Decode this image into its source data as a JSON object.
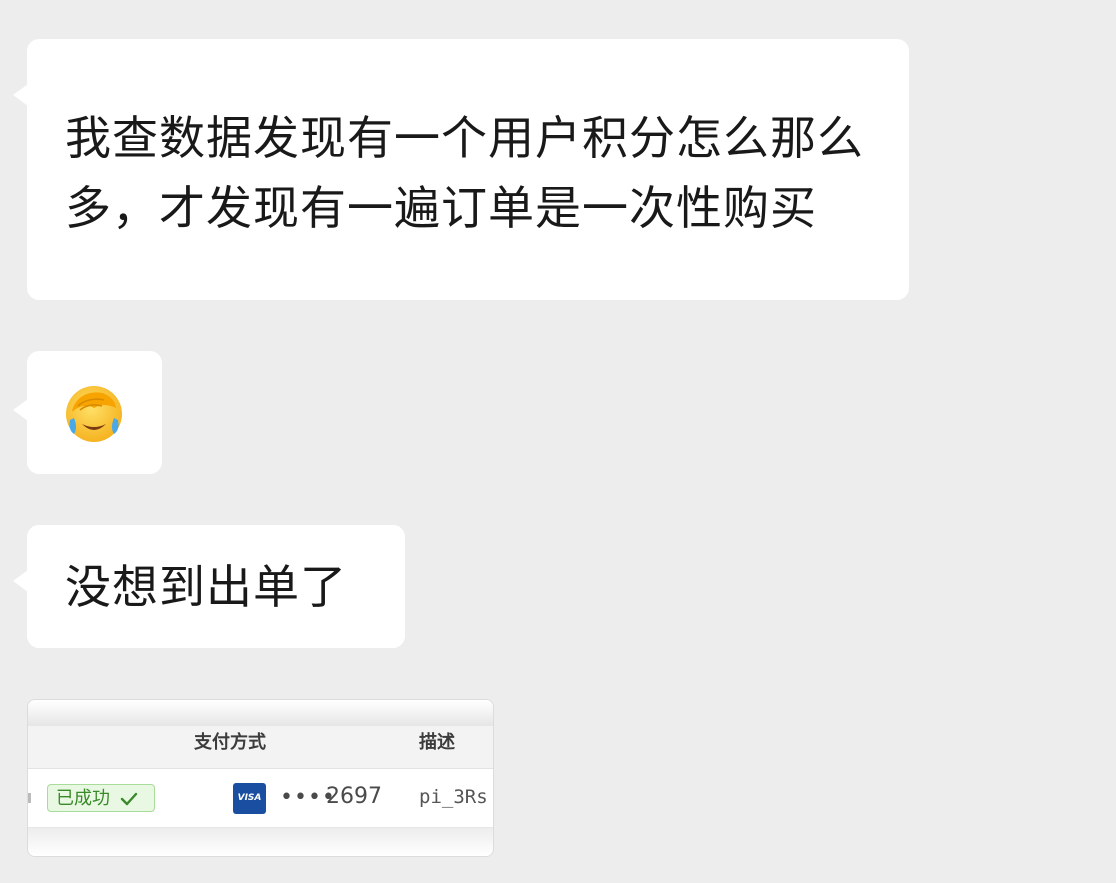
{
  "chat": {
    "messages": [
      {
        "text": "我查数据发现有一个用户积分怎么那么多，才发现有一遍订单是一次性购买"
      },
      {
        "emoji": "face-with-hand-over-eyes-crying-emoji"
      },
      {
        "text": "没想到出单了"
      }
    ],
    "screenshot": {
      "columns": {
        "payment_method": "支付方式",
        "description": "描述"
      },
      "row": {
        "status": "已成功",
        "card_brand": "VISA",
        "card_dots": "••••",
        "card_last4": "2697",
        "description": "pi_3Rs"
      }
    }
  },
  "colors": {
    "background": "#ededed",
    "bubble": "#ffffff",
    "success_badge_bg": "#e8f8e3",
    "success_text": "#3a8a2a",
    "visa_blue": "#1a4ea1"
  }
}
